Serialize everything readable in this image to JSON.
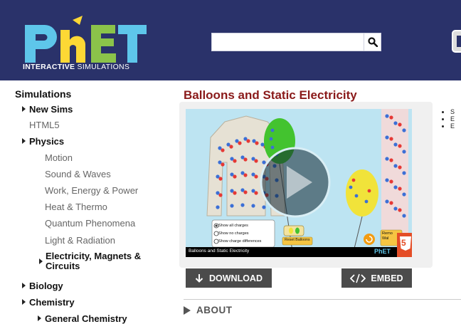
{
  "header": {
    "logo_text": "PhET",
    "logo_tag_bold": "INTERACTIVE",
    "logo_tag_light": "SIMULATIONS",
    "search_value": "",
    "bg_color": "#2a326a"
  },
  "sidebar": {
    "title": "Simulations",
    "items": [
      {
        "label": "New Sims",
        "style": "bold-arrow"
      },
      {
        "label": "HTML5",
        "style": "sub"
      },
      {
        "label": "Physics",
        "style": "bold-arrow"
      },
      {
        "label": "Motion",
        "style": "subsub"
      },
      {
        "label": "Sound & Waves",
        "style": "subsub"
      },
      {
        "label": "Work, Energy & Power",
        "style": "subsub"
      },
      {
        "label": "Heat & Thermo",
        "style": "subsub"
      },
      {
        "label": "Quantum Phenomena",
        "style": "subsub"
      },
      {
        "label": "Light & Radiation",
        "style": "subsub"
      },
      {
        "label": "Electricity, Magnets &",
        "label2": "Circuits",
        "style": "bold-arrow-sub"
      },
      {
        "label": "Biology",
        "style": "bold-arrow"
      },
      {
        "label": "Chemistry",
        "style": "bold-arrow"
      },
      {
        "label": "General Chemistry",
        "style": "bold-arrow-sub"
      }
    ]
  },
  "main": {
    "title": "Balloons and Static Electricity",
    "title_color": "#8a1a1a",
    "video": {
      "caption": "Balloons and Static Electricity",
      "radio_options": [
        "Show all charges",
        "Show no charges",
        "Show charge differences"
      ],
      "reset_label": "Reset Balloons",
      "remove_wall_label_1": "Remo",
      "remove_wall_label_2": "Wal",
      "badge_text": "PhET",
      "html5_badge": "5"
    },
    "download_label": "DOWNLOAD",
    "embed_label": "EMBED",
    "about_label": "ABOUT"
  }
}
